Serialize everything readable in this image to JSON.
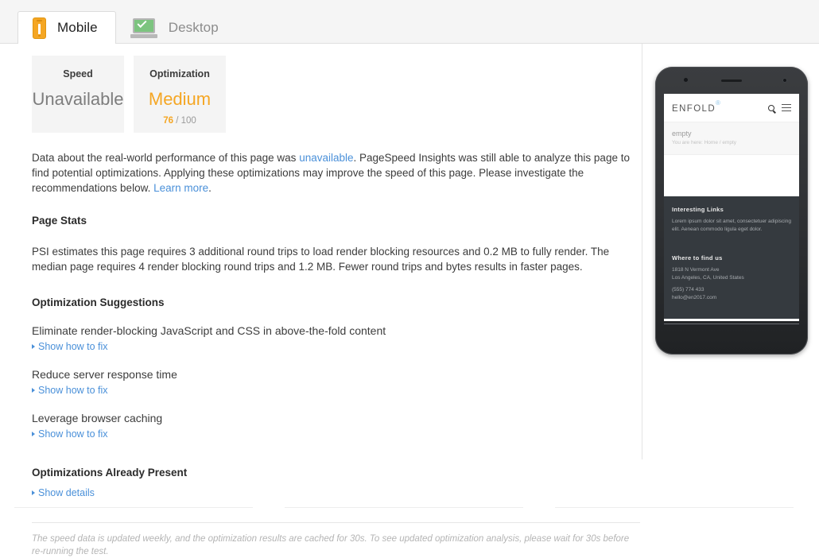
{
  "tabs": [
    {
      "label": "Mobile",
      "icon": "mobile-phone-warning-icon",
      "active": true
    },
    {
      "label": "Desktop",
      "icon": "laptop-check-icon",
      "active": false
    }
  ],
  "scores": {
    "speed": {
      "title": "Speed",
      "value": "Unavailable"
    },
    "optimization": {
      "title": "Optimization",
      "value": "Medium",
      "score": "76",
      "out_of": "/ 100",
      "color": "#f5a623"
    }
  },
  "intro": {
    "part1": "Data about the real-world performance of this page was ",
    "link1": "unavailable",
    "part2": ". PageSpeed Insights was still able to analyze this page to find potential optimizations. Applying these optimizations may improve the speed of this page. Please investigate the recommendations below. ",
    "link2": "Learn more",
    "part3": "."
  },
  "page_stats": {
    "heading": "Page Stats",
    "text": "PSI estimates this page requires 3 additional round trips to load render blocking resources and 0.2 MB to fully render. The median page requires 4 render blocking round trips and 1.2 MB. Fewer round trips and bytes results in faster pages."
  },
  "suggestions": {
    "heading": "Optimization Suggestions",
    "items": [
      {
        "title": "Eliminate render-blocking JavaScript and CSS in above-the-fold content",
        "action": "Show how to fix"
      },
      {
        "title": "Reduce server response time",
        "action": "Show how to fix"
      },
      {
        "title": "Leverage browser caching",
        "action": "Show how to fix"
      }
    ]
  },
  "already_present": {
    "heading": "Optimizations Already Present",
    "action": "Show details"
  },
  "footer_note": "The speed data is updated weekly, and the optimization results are cached for 30s. To see updated optimization analysis, please wait for 30s before re-running the test.",
  "preview": {
    "logo": "ENFOLD",
    "logo_mark": "®",
    "crumb_title": "empty",
    "crumb_path": "You are here: Home / empty",
    "footer": {
      "links_heading": "Interesting Links",
      "links_text": "Lorem ipsum dolor sit amet, consectetuer adipiscing elit. Aenean commodo ligula eget dolor.",
      "find_heading": "Where to find us",
      "address1": "1818 N Vermont Ave",
      "address2": "Los Angeles, CA, United States",
      "phone": "(555) 774 433",
      "email": "hello@en2017.com"
    }
  }
}
